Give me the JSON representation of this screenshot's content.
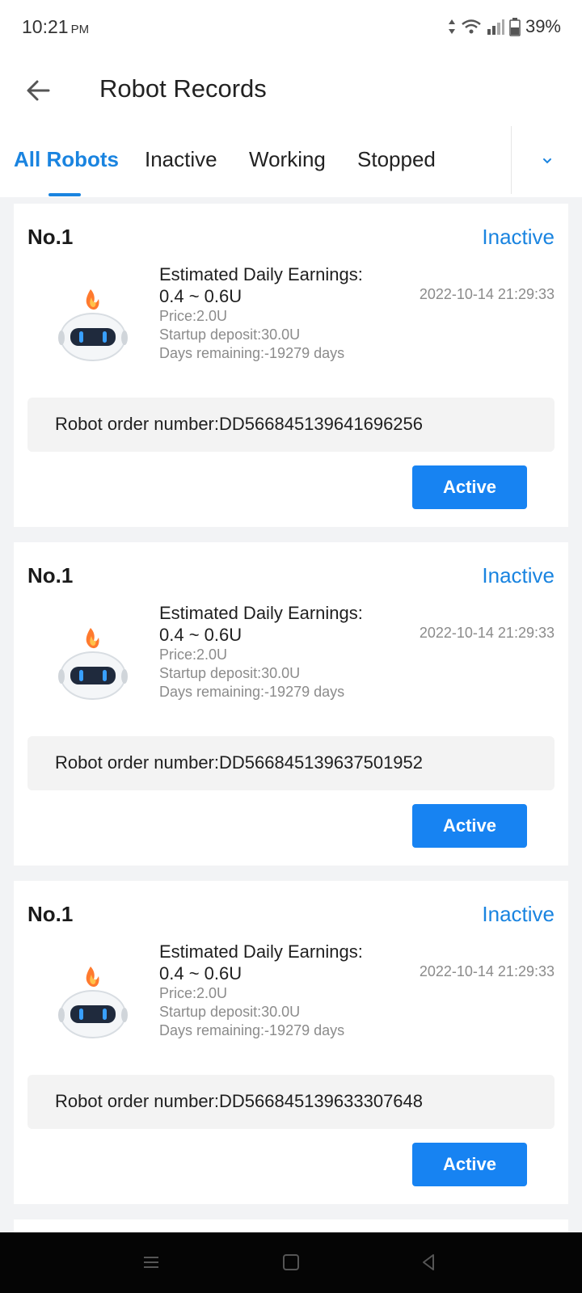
{
  "status_bar": {
    "time": "10:21",
    "ampm": "PM",
    "battery": "39%",
    "icons": [
      "data-arrows-icon",
      "wifi-icon",
      "signal-icon",
      "battery-icon"
    ]
  },
  "header": {
    "title": "Robot Records",
    "back_icon": "arrow-left-icon"
  },
  "tabs": {
    "items": [
      "All Robots",
      "Inactive",
      "Working",
      "Stopped"
    ],
    "active_index": 0,
    "dropdown_icon": "chevron-down-icon"
  },
  "cards": [
    {
      "no": "No.1",
      "status": "Inactive",
      "est_label": "Estimated Daily Earnings:",
      "est_value": "0.4 ~ 0.6U",
      "price": "Price:2.0U",
      "deposit": "Startup deposit:30.0U",
      "days": "Days remaining:-19279 days",
      "date": "2022-10-14 21:29:33",
      "order": "Robot order number:DD566845139641696256",
      "button": "Active"
    },
    {
      "no": "No.1",
      "status": "Inactive",
      "est_label": "Estimated Daily Earnings:",
      "est_value": "0.4 ~ 0.6U",
      "price": "Price:2.0U",
      "deposit": "Startup deposit:30.0U",
      "days": "Days remaining:-19279 days",
      "date": "2022-10-14 21:29:33",
      "order": "Robot order number:DD566845139637501952",
      "button": "Active"
    },
    {
      "no": "No.1",
      "status": "Inactive",
      "est_label": "Estimated Daily Earnings:",
      "est_value": "0.4 ~ 0.6U",
      "price": "Price:2.0U",
      "deposit": "Startup deposit:30.0U",
      "days": "Days remaining:-19279 days",
      "date": "2022-10-14 21:29:33",
      "order": "Robot order number:DD566845139633307648",
      "button": "Active"
    }
  ],
  "nav_bar": {
    "icons": [
      "menu-icon",
      "home-icon",
      "back-triangle-icon"
    ]
  },
  "colors": {
    "accent": "#1a84e0",
    "button": "#1783f2",
    "background": "#f2f3f5"
  }
}
